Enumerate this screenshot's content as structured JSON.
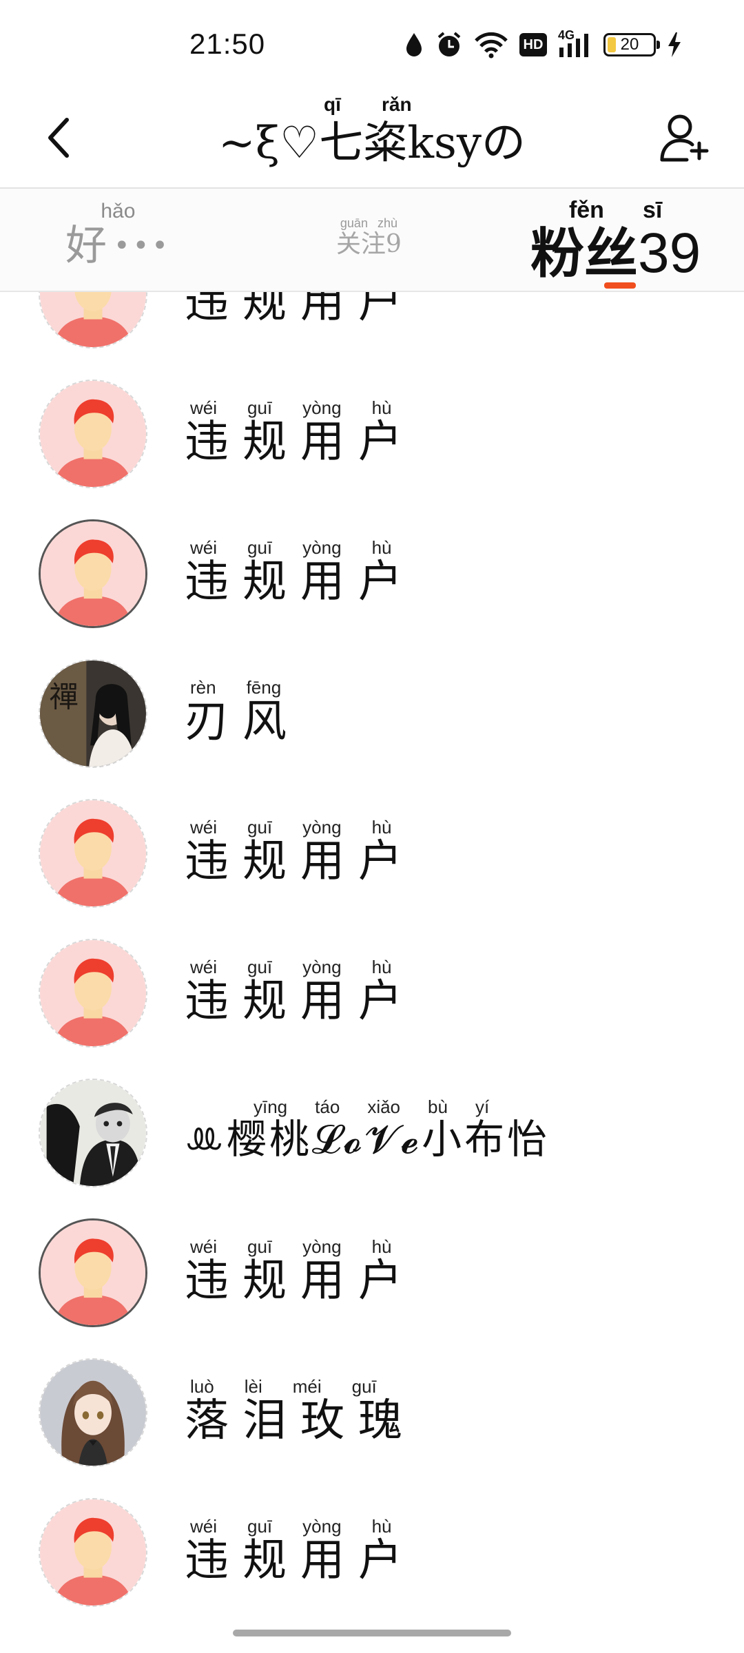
{
  "status_bar": {
    "time": "21:50",
    "hd": "HD",
    "network": "4G",
    "battery": "20"
  },
  "header": {
    "title": "~ξ♡七粢ksyの",
    "title_pinyin_qi": "qī",
    "title_pinyin_ran": "rǎn",
    "back_icon": "chevron-left-icon",
    "add_friend_icon": "add-user-icon"
  },
  "tabs": {
    "friends": {
      "pinyin": [
        "hǎo"
      ],
      "label": "好",
      "more": "•••"
    },
    "following": {
      "pinyin": [
        "guān",
        "zhù"
      ],
      "label": "关注9"
    },
    "fans": {
      "pinyin": [
        "fěn",
        "sī"
      ],
      "label": "粉丝",
      "count": "39"
    },
    "active_color": "#f04e1e"
  },
  "users": [
    {
      "name": "违规用户",
      "pinyin": [
        "wéi",
        "guī",
        "yòng",
        "hù"
      ],
      "avatar": "default"
    },
    {
      "name": "违规用户",
      "pinyin": [
        "wéi",
        "guī",
        "yòng",
        "hù"
      ],
      "avatar": "default"
    },
    {
      "name": "违规用户",
      "pinyin": [
        "wéi",
        "guī",
        "yòng",
        "hù"
      ],
      "avatar": "default-solid"
    },
    {
      "name": "刃风",
      "pinyin": [
        "rèn",
        "fēng"
      ],
      "avatar": "photo-woman-zen"
    },
    {
      "name": "违规用户",
      "pinyin": [
        "wéi",
        "guī",
        "yòng",
        "hù"
      ],
      "avatar": "default"
    },
    {
      "name": "违规用户",
      "pinyin": [
        "wéi",
        "guī",
        "yòng",
        "hù"
      ],
      "avatar": "default"
    },
    {
      "name": "ꔛ樱桃𝓛𝓸𝓥𝓮小布怡",
      "pinyin": [
        "yīng",
        "táo",
        "xiǎo",
        "bù",
        "yí"
      ],
      "avatar": "photo-suit-character"
    },
    {
      "name": "违规用户",
      "pinyin": [
        "wéi",
        "guī",
        "yòng",
        "hù"
      ],
      "avatar": "default-solid"
    },
    {
      "name": "落泪玫瑰",
      "pinyin": [
        "luò",
        "lèi",
        "méi",
        "guī"
      ],
      "avatar": "photo-anime-girl"
    },
    {
      "name": "违规用户",
      "pinyin": [
        "wéi",
        "guī",
        "yòng",
        "hù"
      ],
      "avatar": "default"
    }
  ]
}
